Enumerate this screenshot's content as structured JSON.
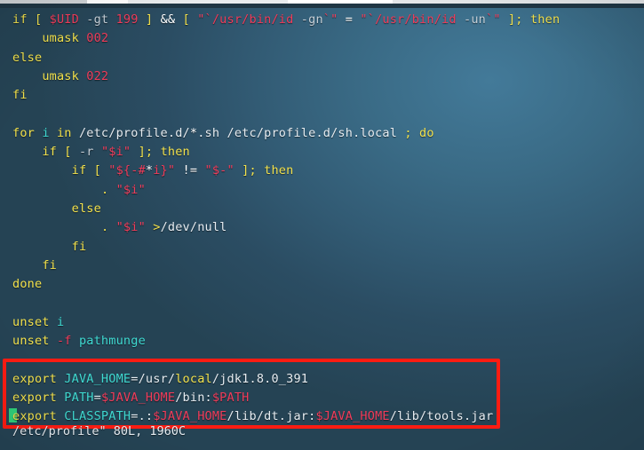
{
  "window": {
    "chrome_strip_visible": true
  },
  "editor": {
    "app": "vim",
    "filename": "/etc/profile",
    "statusline": "/etc/profile\" 80L, 1960C",
    "cursor_line_index": 18,
    "cursor_column": 1,
    "background_color": "#35647e",
    "colors": {
      "keyword": "#f2e14c",
      "variable": "#f03c5a",
      "string": "#f03c5a",
      "identifier": "#3fd9d1",
      "normal": "#e7edf2",
      "flag": "#c4ced6",
      "cursor": "#2fcf7a",
      "annotation_box": "#fd1c12"
    }
  },
  "annotation": {
    "type": "red-rectangle",
    "color": "#fd1c12",
    "covers_lines": [
      16,
      17,
      18
    ],
    "label": "java-env-export-highlight"
  },
  "code_lines": [
    {
      "n": 1,
      "indent": 0,
      "tokens": [
        {
          "t": "if ",
          "c": "kw"
        },
        {
          "t": "[ ",
          "c": "kw"
        },
        {
          "t": "$UID",
          "c": "var"
        },
        {
          "t": " ",
          "c": "txt"
        },
        {
          "t": "-gt",
          "c": "dim"
        },
        {
          "t": " ",
          "c": "txt"
        },
        {
          "t": "199",
          "c": "num"
        },
        {
          "t": " ",
          "c": "txt"
        },
        {
          "t": "]",
          "c": "kw"
        },
        {
          "t": " ",
          "c": "txt"
        },
        {
          "t": "&&",
          "c": "op"
        },
        {
          "t": " ",
          "c": "txt"
        },
        {
          "t": "[",
          "c": "kw"
        },
        {
          "t": " ",
          "c": "txt"
        },
        {
          "t": "\"`/usr/bin/id",
          "c": "str"
        },
        {
          "t": " ",
          "c": "txt"
        },
        {
          "t": "-gn",
          "c": "dim"
        },
        {
          "t": "`\"",
          "c": "str"
        },
        {
          "t": " ",
          "c": "txt"
        },
        {
          "t": "=",
          "c": "op"
        },
        {
          "t": " ",
          "c": "txt"
        },
        {
          "t": "\"`/usr/bin/id",
          "c": "str"
        },
        {
          "t": " ",
          "c": "txt"
        },
        {
          "t": "-un",
          "c": "dim"
        },
        {
          "t": "`\"",
          "c": "str"
        },
        {
          "t": " ",
          "c": "txt"
        },
        {
          "t": "];",
          "c": "kw"
        },
        {
          "t": " ",
          "c": "txt"
        },
        {
          "t": "then",
          "c": "kw"
        }
      ]
    },
    {
      "n": 2,
      "indent": 4,
      "tokens": [
        {
          "t": "umask",
          "c": "kw"
        },
        {
          "t": " ",
          "c": "txt"
        },
        {
          "t": "002",
          "c": "num"
        }
      ]
    },
    {
      "n": 3,
      "indent": 0,
      "tokens": [
        {
          "t": "else",
          "c": "kw"
        }
      ]
    },
    {
      "n": 4,
      "indent": 4,
      "tokens": [
        {
          "t": "umask",
          "c": "kw"
        },
        {
          "t": " ",
          "c": "txt"
        },
        {
          "t": "022",
          "c": "num"
        }
      ]
    },
    {
      "n": 5,
      "indent": 0,
      "tokens": [
        {
          "t": "fi",
          "c": "kw"
        }
      ]
    },
    {
      "n": 6,
      "indent": 0,
      "tokens": []
    },
    {
      "n": 7,
      "indent": 0,
      "tokens": [
        {
          "t": "for",
          "c": "kw"
        },
        {
          "t": " ",
          "c": "txt"
        },
        {
          "t": "i",
          "c": "idn"
        },
        {
          "t": " ",
          "c": "txt"
        },
        {
          "t": "in",
          "c": "kw"
        },
        {
          "t": " ",
          "c": "txt"
        },
        {
          "t": "/etc/profile.d/",
          "c": "txt"
        },
        {
          "t": "*",
          "c": "op"
        },
        {
          "t": ".sh /etc/profile.d/sh.local",
          "c": "txt"
        },
        {
          "t": " ",
          "c": "txt"
        },
        {
          "t": ";",
          "c": "kw"
        },
        {
          "t": " ",
          "c": "txt"
        },
        {
          "t": "do",
          "c": "kw"
        }
      ]
    },
    {
      "n": 8,
      "indent": 4,
      "tokens": [
        {
          "t": "if",
          "c": "kw"
        },
        {
          "t": " ",
          "c": "txt"
        },
        {
          "t": "[",
          "c": "kw"
        },
        {
          "t": " ",
          "c": "txt"
        },
        {
          "t": "-r",
          "c": "dim"
        },
        {
          "t": " ",
          "c": "txt"
        },
        {
          "t": "\"",
          "c": "str"
        },
        {
          "t": "$i",
          "c": "var"
        },
        {
          "t": "\"",
          "c": "str"
        },
        {
          "t": " ",
          "c": "txt"
        },
        {
          "t": "];",
          "c": "kw"
        },
        {
          "t": " ",
          "c": "txt"
        },
        {
          "t": "then",
          "c": "kw"
        }
      ]
    },
    {
      "n": 9,
      "indent": 8,
      "tokens": [
        {
          "t": "if",
          "c": "kw"
        },
        {
          "t": " ",
          "c": "txt"
        },
        {
          "t": "[",
          "c": "kw"
        },
        {
          "t": " ",
          "c": "txt"
        },
        {
          "t": "\"",
          "c": "str"
        },
        {
          "t": "${-#",
          "c": "var"
        },
        {
          "t": "*",
          "c": "op"
        },
        {
          "t": "i}",
          "c": "var"
        },
        {
          "t": "\"",
          "c": "str"
        },
        {
          "t": " ",
          "c": "txt"
        },
        {
          "t": "!=",
          "c": "op"
        },
        {
          "t": " ",
          "c": "txt"
        },
        {
          "t": "\"",
          "c": "str"
        },
        {
          "t": "$-",
          "c": "var"
        },
        {
          "t": "\"",
          "c": "str"
        },
        {
          "t": " ",
          "c": "txt"
        },
        {
          "t": "];",
          "c": "kw"
        },
        {
          "t": " ",
          "c": "txt"
        },
        {
          "t": "then",
          "c": "kw"
        }
      ]
    },
    {
      "n": 10,
      "indent": 12,
      "tokens": [
        {
          "t": ".",
          "c": "kw"
        },
        {
          "t": " ",
          "c": "txt"
        },
        {
          "t": "\"",
          "c": "str"
        },
        {
          "t": "$i",
          "c": "var"
        },
        {
          "t": "\"",
          "c": "str"
        }
      ]
    },
    {
      "n": 11,
      "indent": 8,
      "tokens": [
        {
          "t": "else",
          "c": "kw"
        }
      ]
    },
    {
      "n": 12,
      "indent": 12,
      "tokens": [
        {
          "t": ".",
          "c": "kw"
        },
        {
          "t": " ",
          "c": "txt"
        },
        {
          "t": "\"",
          "c": "str"
        },
        {
          "t": "$i",
          "c": "var"
        },
        {
          "t": "\"",
          "c": "str"
        },
        {
          "t": " ",
          "c": "txt"
        },
        {
          "t": ">",
          "c": "kw"
        },
        {
          "t": "/dev/null",
          "c": "txt"
        }
      ]
    },
    {
      "n": 13,
      "indent": 8,
      "tokens": [
        {
          "t": "fi",
          "c": "kw"
        }
      ]
    },
    {
      "n": 14,
      "indent": 4,
      "tokens": [
        {
          "t": "fi",
          "c": "kw"
        }
      ]
    },
    {
      "n": 15,
      "indent": 0,
      "tokens": [
        {
          "t": "done",
          "c": "kw"
        }
      ]
    },
    {
      "n": 16,
      "indent": 0,
      "tokens": []
    },
    {
      "n": 17,
      "indent": 0,
      "tokens": [
        {
          "t": "unset",
          "c": "kw"
        },
        {
          "t": " ",
          "c": "txt"
        },
        {
          "t": "i",
          "c": "idn"
        }
      ]
    },
    {
      "n": 18,
      "indent": 0,
      "tokens": [
        {
          "t": "unset",
          "c": "kw"
        },
        {
          "t": " ",
          "c": "txt"
        },
        {
          "t": "-f",
          "c": "var"
        },
        {
          "t": " ",
          "c": "txt"
        },
        {
          "t": "pathmunge",
          "c": "idn"
        }
      ]
    },
    {
      "n": 19,
      "indent": 0,
      "tokens": []
    },
    {
      "n": 20,
      "indent": 0,
      "tokens": [
        {
          "t": "export",
          "c": "kw"
        },
        {
          "t": " ",
          "c": "txt"
        },
        {
          "t": "JAVA_HOME",
          "c": "idn"
        },
        {
          "t": "=",
          "c": "txt"
        },
        {
          "t": "/usr/",
          "c": "txt"
        },
        {
          "t": "local",
          "c": "dir"
        },
        {
          "t": "/jdk1.8.0_391",
          "c": "txt"
        }
      ]
    },
    {
      "n": 21,
      "indent": 0,
      "tokens": [
        {
          "t": "export",
          "c": "kw"
        },
        {
          "t": " ",
          "c": "txt"
        },
        {
          "t": "PATH",
          "c": "idn"
        },
        {
          "t": "=",
          "c": "txt"
        },
        {
          "t": "$JAVA_HOME",
          "c": "var"
        },
        {
          "t": "/bin:",
          "c": "txt"
        },
        {
          "t": "$PATH",
          "c": "var"
        }
      ]
    },
    {
      "n": 22,
      "indent": 0,
      "cursor": true,
      "tokens": [
        {
          "t": "export",
          "c": "kw"
        },
        {
          "t": " ",
          "c": "txt"
        },
        {
          "t": "CLASSPATH",
          "c": "idn"
        },
        {
          "t": "=",
          "c": "txt"
        },
        {
          "t": ".:",
          "c": "txt"
        },
        {
          "t": "$JAVA_HOME",
          "c": "var"
        },
        {
          "t": "/lib/dt.jar:",
          "c": "txt"
        },
        {
          "t": "$JAVA_HOME",
          "c": "var"
        },
        {
          "t": "/lib/tools.jar",
          "c": "txt"
        }
      ]
    }
  ]
}
